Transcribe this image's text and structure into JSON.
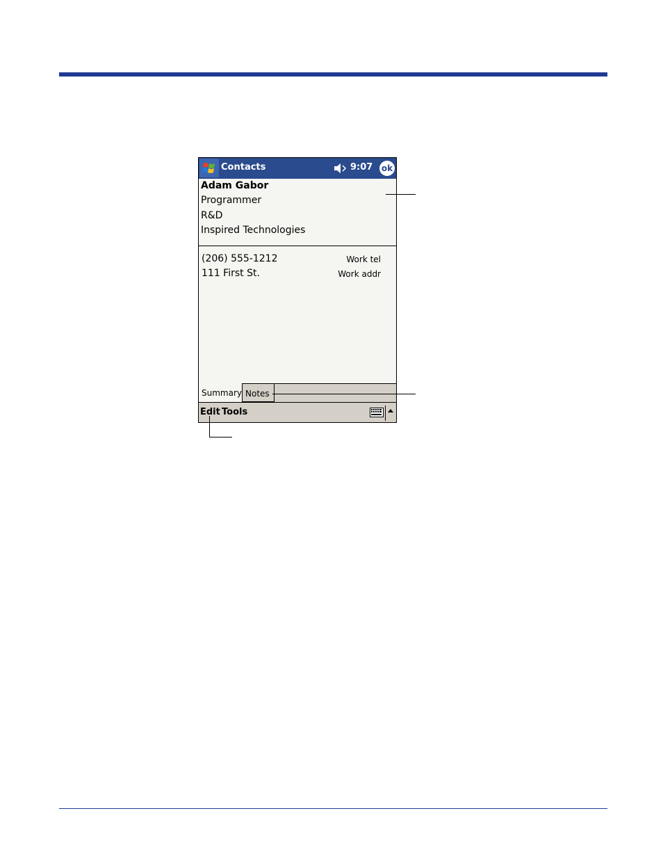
{
  "titlebar": {
    "app_title": "Contacts",
    "time": "9:07",
    "ok_label": "ok",
    "start_icon": "windows-flag-icon",
    "speaker_icon": "speaker-muted-icon"
  },
  "contact": {
    "name": "Adam Gabor",
    "job_title": "Programmer",
    "department": "R&D",
    "company": "Inspired Technologies"
  },
  "details": [
    {
      "value": "(206) 555-1212",
      "label": "Work tel"
    },
    {
      "value": "111 First St.",
      "label": "Work addr"
    }
  ],
  "tabs": [
    {
      "label": "Summary",
      "selected": true
    },
    {
      "label": "Notes",
      "selected": false
    }
  ],
  "menubar": {
    "edit": "Edit",
    "tools": "Tools",
    "keyboard_icon": "keyboard-icon",
    "sip_icon": "sip-up-arrow-icon"
  },
  "colors": {
    "accent": "#1f3a93",
    "titlebar": "#2a4b8d",
    "chrome": "#d4d0c8",
    "canvas": "#f5f5f1"
  }
}
